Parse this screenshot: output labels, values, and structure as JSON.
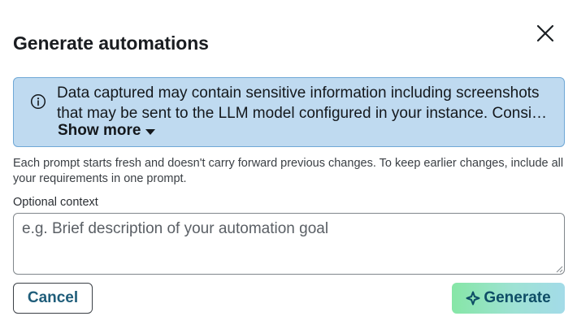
{
  "dialog": {
    "title": "Generate automations",
    "close_icon": "close-icon"
  },
  "info": {
    "icon": "info-icon",
    "line1": "Data captured may contain sensitive information including screenshots",
    "line2": "that may be sent to the LLM model configured in your instance. Consider...",
    "show_more_label": "Show more",
    "background_color": "#bfdaf0",
    "border_color": "#6fa8d6"
  },
  "hint": {
    "line1": "Each prompt starts fresh and doesn't carry forward previous changes. To keep earlier changes, include all",
    "line2": "your requirements in one prompt."
  },
  "context": {
    "label": "Optional context",
    "placeholder": "e.g. Brief description of your automation goal",
    "value": ""
  },
  "actions": {
    "cancel_label": "Cancel",
    "generate_label": "Generate",
    "generate_icon": "sparkle-icon",
    "accent_color": "#0e4d66"
  }
}
